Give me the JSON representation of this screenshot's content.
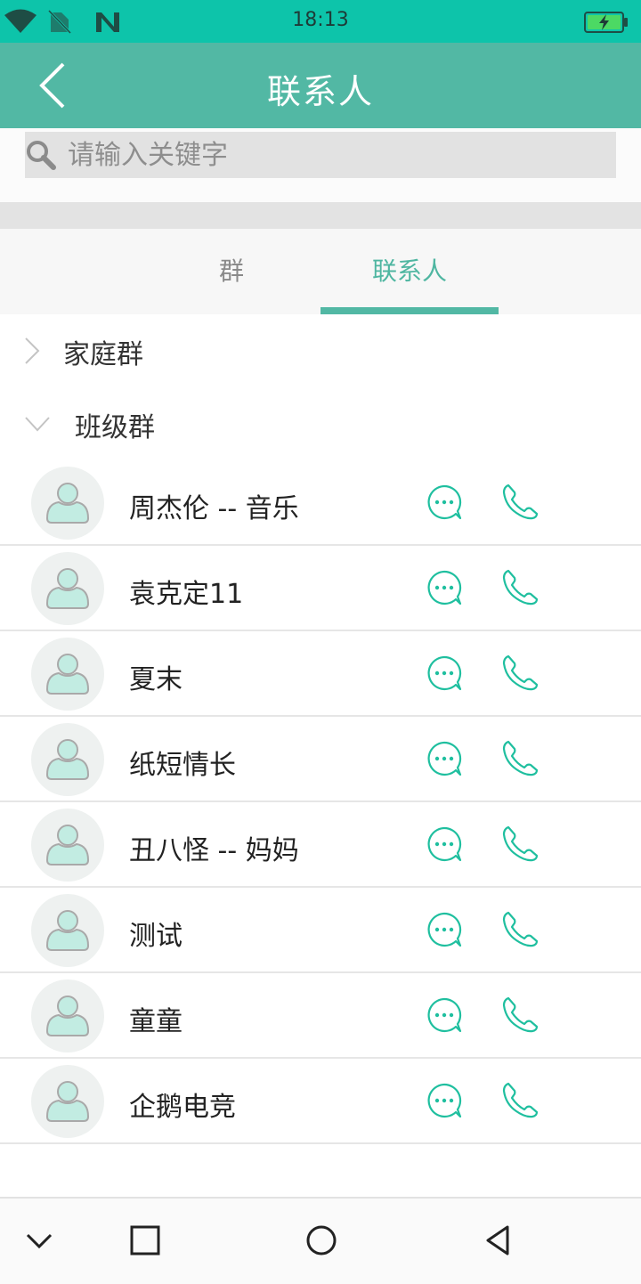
{
  "status_bar": {
    "time": "18:13",
    "icons": [
      "wifi-icon",
      "no-sim-icon",
      "notification-n-icon",
      "battery-charging-icon"
    ],
    "battery_color": "#4cd964"
  },
  "app_bar": {
    "title": "联系人",
    "back_icon": "back-chevron-icon"
  },
  "search": {
    "placeholder": "请输入关键字",
    "value": ""
  },
  "tabs": [
    {
      "label": "群",
      "active": false
    },
    {
      "label": "联系人",
      "active": true
    }
  ],
  "groups": [
    {
      "label": "家庭群",
      "expanded": false
    },
    {
      "label": "班级群",
      "expanded": true,
      "contacts": [
        {
          "name": "周杰伦 -- 音乐"
        },
        {
          "name": "袁克定11"
        },
        {
          "name": "夏末"
        },
        {
          "name": "纸短情长"
        },
        {
          "name": "丑八怪 -- 妈妈"
        },
        {
          "name": "测试"
        },
        {
          "name": "童童"
        },
        {
          "name": "企鹅电竞"
        }
      ]
    }
  ],
  "nav_bar": {
    "icons": [
      "collapse-chevron-icon",
      "recents-square-icon",
      "home-circle-icon",
      "back-triangle-icon"
    ]
  },
  "colors": {
    "status_bar": "#0dc4aa",
    "app_bar": "#52b8a4",
    "accent": "#1fbf9f",
    "avatar_fill": "#c2ece2"
  }
}
